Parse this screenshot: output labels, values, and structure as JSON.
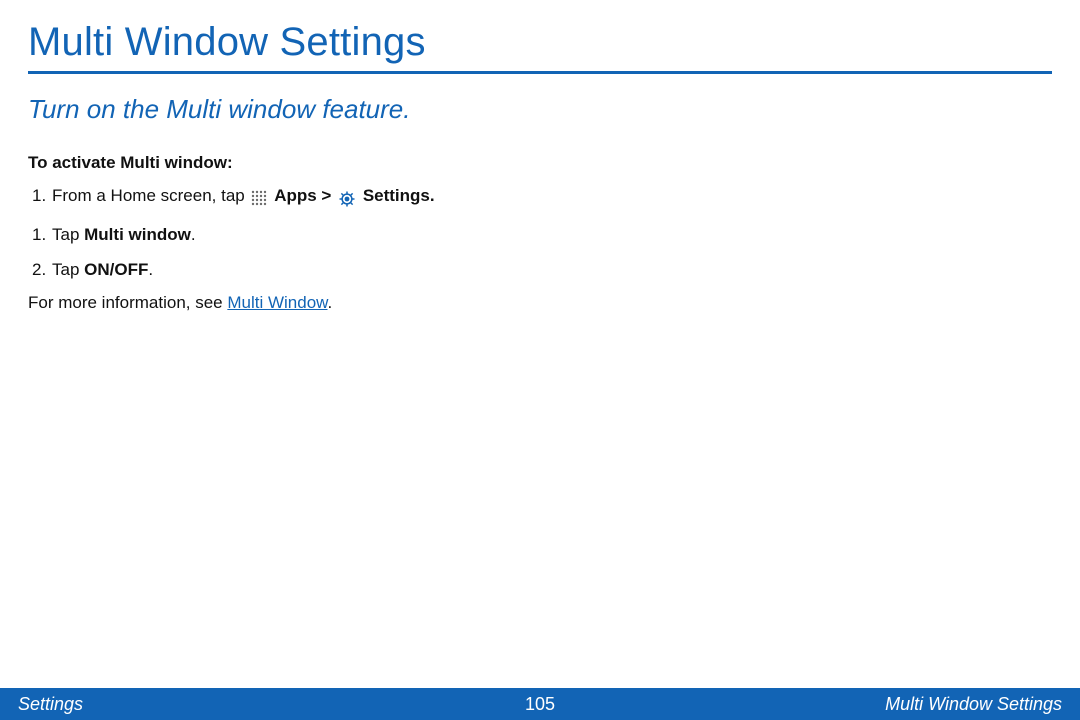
{
  "page": {
    "title": "Multi Window Settings",
    "subtitle": "Turn on the Multi window feature.",
    "section_head": "To activate Multi window:",
    "step1": {
      "num": "1.",
      "prefix": "From a Home screen, tap ",
      "apps_label": "Apps",
      "gt": " > ",
      "settings_label": "Settings."
    },
    "step2": {
      "num": "1.",
      "prefix": "Tap ",
      "bold": "Multi window",
      "suffix": "."
    },
    "step3": {
      "num": "2.",
      "prefix": "Tap ",
      "bold": "ON/OFF",
      "suffix": "."
    },
    "more_info_prefix": "For more information, see ",
    "more_info_link": "Multi Window",
    "more_info_suffix": "."
  },
  "footer": {
    "left": "Settings",
    "center": "105",
    "right": "Multi Window Settings"
  }
}
